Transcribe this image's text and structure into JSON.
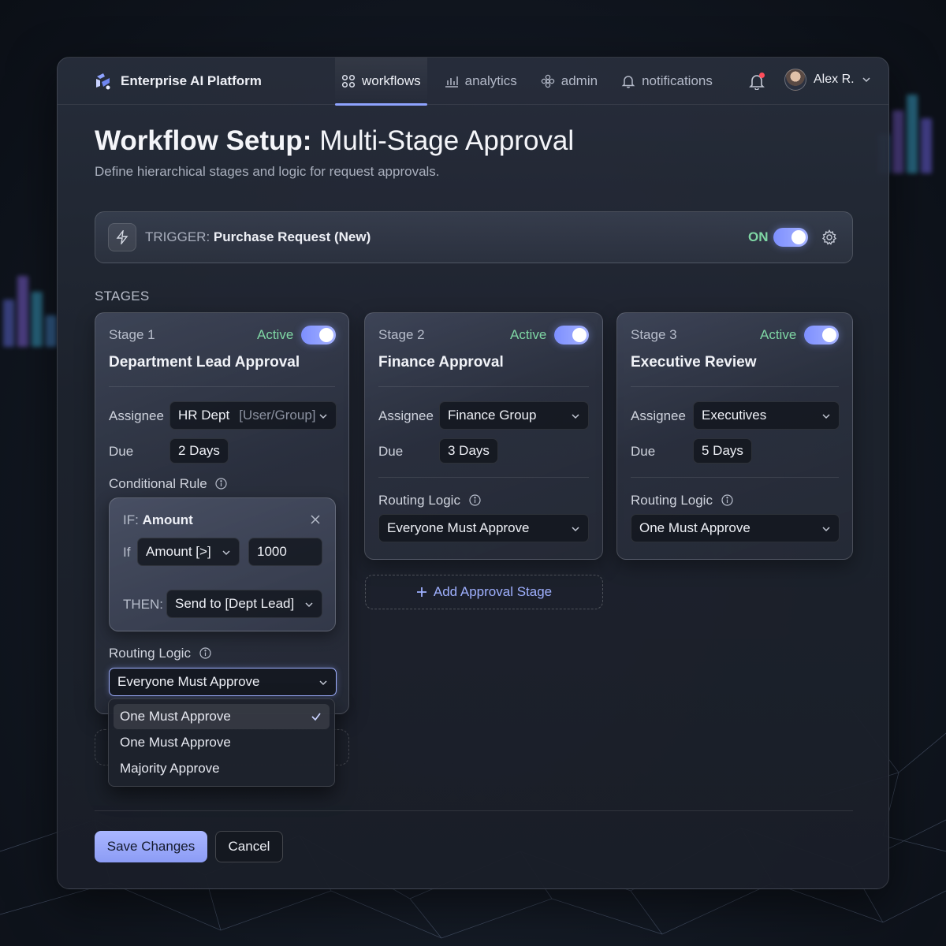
{
  "app": {
    "title": "Enterprise AI Platform"
  },
  "nav": {
    "workflows": "workflows",
    "analytics": "analytics",
    "admin": "admin",
    "notifications": "notifications"
  },
  "user": {
    "name": "Alex R."
  },
  "page": {
    "title_bold": "Workflow Setup:",
    "title_rest": "Multi-Stage Approval",
    "subtitle": "Define hierarchical stages and logic for request approvals."
  },
  "trigger": {
    "label": "TRIGGER:",
    "value": "Purchase Request (New)",
    "state": "ON"
  },
  "stages_label": "STAGES",
  "labels": {
    "active": "Active",
    "assignee": "Assignee",
    "due": "Due",
    "conditional_rule": "Conditional Rule",
    "routing_logic": "Routing Logic"
  },
  "stages": [
    {
      "num": "Stage 1",
      "name": "Department Lead Approval",
      "assignee": "HR Dept",
      "assignee_hint": "[User/Group]",
      "due": "2 Days",
      "routing": "Everyone Must Approve"
    },
    {
      "num": "Stage 2",
      "name": "Finance Approval",
      "assignee": "Finance Group",
      "due": "3 Days",
      "routing": "Everyone Must Approve"
    },
    {
      "num": "Stage 3",
      "name": "Executive Review",
      "assignee": "Executives",
      "due": "5 Days",
      "routing": "One Must Approve"
    }
  ],
  "condition": {
    "if_label": "IF:",
    "if_field": "Amount",
    "if_word": "If",
    "operator": "Amount [>]",
    "value": "1000",
    "then_label": "THEN:",
    "then_value": "Send to [Dept Lead]"
  },
  "routing_options": [
    "One Must Approve",
    "One Must Approve",
    "Majority Approve"
  ],
  "add_stage": "Add Approval Stage",
  "buttons": {
    "save": "Save Changes",
    "cancel": "Cancel"
  },
  "colors": {
    "accent": "#8ea3ff",
    "active_green": "#7fd6a4",
    "notification_dot": "#ff4d5b"
  }
}
